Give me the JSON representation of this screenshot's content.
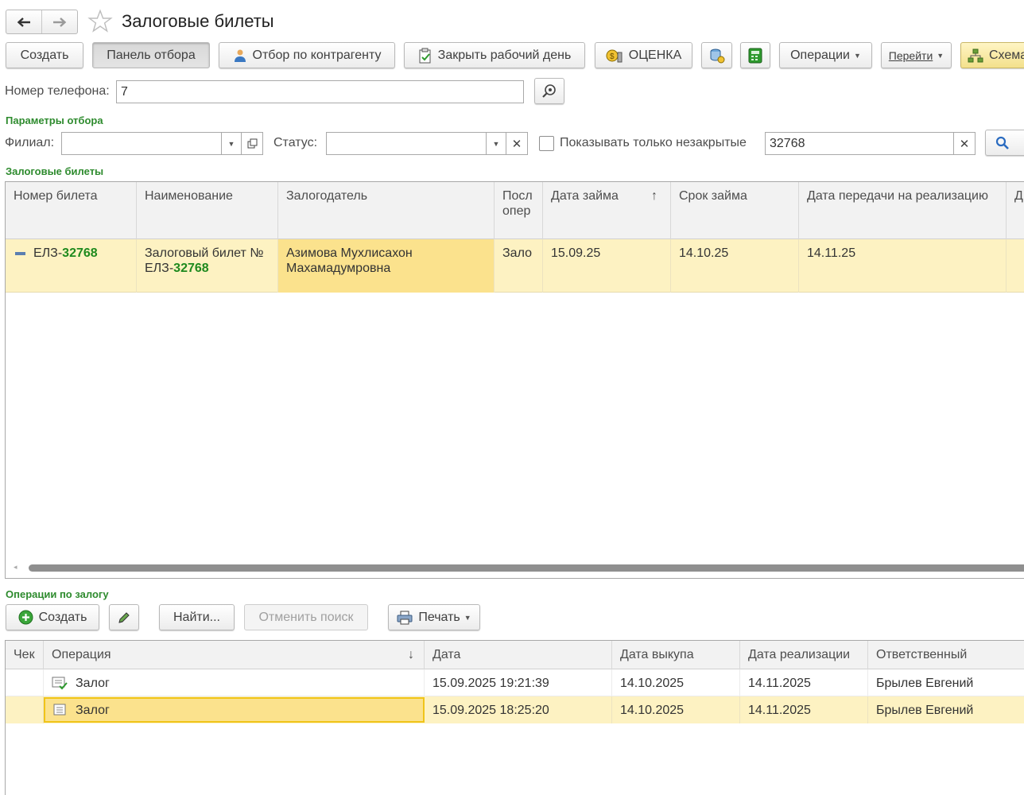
{
  "window": {
    "title": "Залоговые билеты"
  },
  "toolbar": {
    "create": "Создать",
    "filter_panel": "Панель отбора",
    "by_counterparty": "Отбор по контрагенту",
    "close_day": "Закрыть рабочий день",
    "appraisal": "ОЦЕНКА",
    "operations": "Операции",
    "goto": "Перейти",
    "scheme": "Схема"
  },
  "phone": {
    "label": "Номер телефона:",
    "value": "7"
  },
  "filters": {
    "section_title": "Параметры отбора",
    "branch_label": "Филиал:",
    "branch_value": "",
    "status_label": "Статус:",
    "status_value": "",
    "only_open_label": "Показывать только незакрытые",
    "only_open_checked": false,
    "search_value": "32768"
  },
  "tickets": {
    "section_title": "Залоговые билеты",
    "columns": [
      "Номер билета",
      "Наименование",
      "Залогодатель",
      "Посл опер",
      "Дата займа",
      "Срок займа",
      "Дата передачи на реализацию",
      "Д"
    ],
    "sort_indicator": "↑",
    "rows": [
      {
        "number_prefix": "ЕЛЗ-",
        "number_hl": "32768",
        "name_line1": "Залоговый билет №",
        "name_prefix": "ЕЛЗ-",
        "name_hl": "32768",
        "pledger_line1": "Азимова Мухлисахон",
        "pledger_line2": "Махамадумровна",
        "last_op": "Зало",
        "loan_date": "15.09.25",
        "term": "14.10.25",
        "transfer_date": "14.11.25"
      }
    ]
  },
  "operations": {
    "section_title": "Операции по залогу",
    "create": "Создать",
    "find": "Найти...",
    "cancel_search": "Отменить поиск",
    "print": "Печать",
    "columns": [
      "Чек",
      "Операция",
      "Дата",
      "Дата выкупа",
      "Дата реализации",
      "Ответственный"
    ],
    "sort_indicator": "↓",
    "rows": [
      {
        "operation": "Залог",
        "date": "15.09.2025 19:21:39",
        "redeem_date": "14.10.2025",
        "sale_date": "14.11.2025",
        "responsible": "Брылев Евгений",
        "posted": true
      },
      {
        "operation": "Залог",
        "date": "15.09.2025 18:25:20",
        "redeem_date": "14.10.2025",
        "sale_date": "14.11.2025",
        "responsible": "Брылев Евгений",
        "posted": false
      }
    ]
  }
}
